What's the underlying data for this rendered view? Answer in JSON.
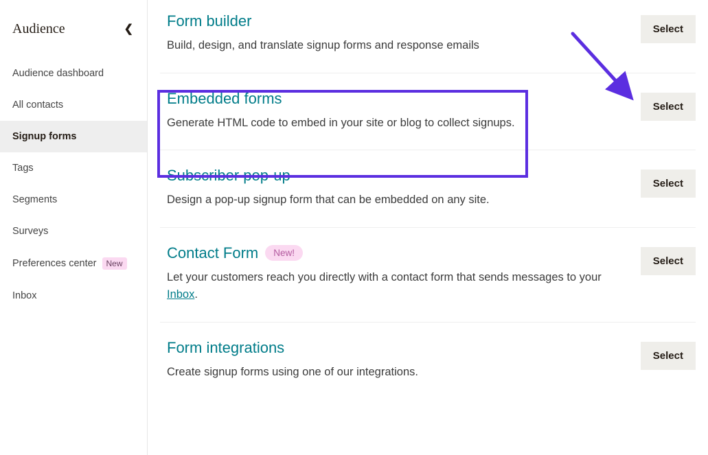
{
  "sidebar": {
    "title": "Audience",
    "items": [
      {
        "label": "Audience dashboard",
        "active": false,
        "badge": null
      },
      {
        "label": "All contacts",
        "active": false,
        "badge": null
      },
      {
        "label": "Signup forms",
        "active": true,
        "badge": null
      },
      {
        "label": "Tags",
        "active": false,
        "badge": null
      },
      {
        "label": "Segments",
        "active": false,
        "badge": null
      },
      {
        "label": "Surveys",
        "active": false,
        "badge": null
      },
      {
        "label": "Preferences center",
        "active": false,
        "badge": "New"
      },
      {
        "label": "Inbox",
        "active": false,
        "badge": null
      }
    ]
  },
  "forms": [
    {
      "title": "Form builder",
      "desc": "Build, design, and translate signup forms and response emails",
      "button": "Select",
      "badge": null
    },
    {
      "title": "Embedded forms",
      "desc": "Generate HTML code to embed in your site or blog to collect signups.",
      "button": "Select",
      "badge": null
    },
    {
      "title": "Subscriber pop-up",
      "desc": "Design a pop-up signup form that can be embedded on any site.",
      "button": "Select",
      "badge": null
    },
    {
      "title": "Contact Form",
      "desc_pre": "Let your customers reach you directly with a contact form that sends messages to your ",
      "desc_link": "Inbox",
      "desc_post": ".",
      "button": "Select",
      "badge": "New!"
    },
    {
      "title": "Form integrations",
      "desc": "Create signup forms using one of our integrations.",
      "button": "Select",
      "badge": null
    }
  ],
  "annotation": {
    "highlight_target": "embedded-forms",
    "arrow_target": "embedded-forms-select-button"
  }
}
